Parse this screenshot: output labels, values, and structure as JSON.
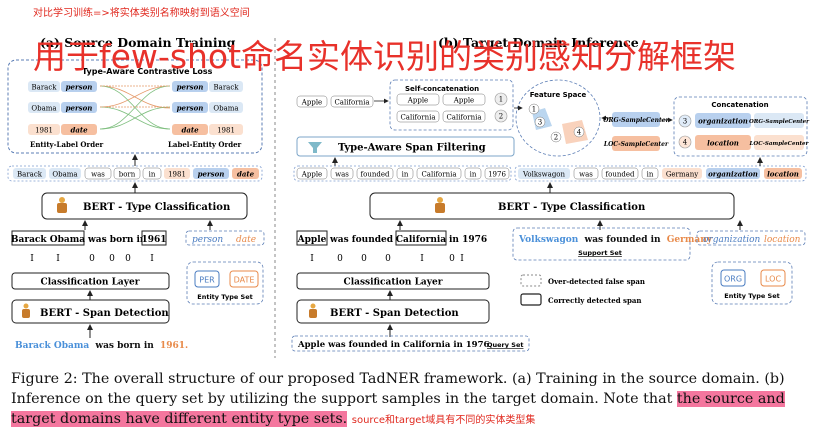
{
  "annotations": {
    "top_note": "对比学习训练=>将实体类别名称映射到语义空间",
    "overlay_title": "用于few-shot命名实体识别的类别感知分解框架",
    "inline_note": "source和target域具有不同的实体类型集"
  },
  "panel_a": {
    "title": "(a) Source Domain Training",
    "contrastive_label": "Type-Aware Contrastive Loss",
    "left_pairs": [
      [
        "Barack",
        "person"
      ],
      [
        "Obama",
        "person"
      ],
      [
        "1981",
        "date"
      ]
    ],
    "right_pairs": [
      [
        "person",
        "Barack"
      ],
      [
        "person",
        "Obama"
      ],
      [
        "date",
        "1981"
      ]
    ],
    "left_order_label": "Entity-Label Order",
    "right_order_label": "Label-Entity Order",
    "token_row": [
      "Barack",
      "Obama",
      "was",
      "born",
      "in",
      "1981",
      "person",
      "date"
    ],
    "bert_type": "BERT - Type Classification",
    "sentence": {
      "entity1": "Barack Obama",
      "mid": "was born in",
      "entity2": "1961"
    },
    "types_inline": [
      "person",
      "date"
    ],
    "binary_labels": [
      "I",
      "I",
      "0",
      "0",
      "0",
      "I"
    ],
    "classification_layer": "Classification Layer",
    "entity_type_boxes": [
      "PER",
      "DATE"
    ],
    "entity_type_set": "Entity Type Set",
    "bert_span": "BERT - Span Detection",
    "input_sentence": {
      "entity": "Barack Obama",
      "mid": "was born in",
      "date": "1961."
    }
  },
  "panel_b": {
    "title": "(b) Target Domain Inference",
    "self_concat_label": "Self-concatenation",
    "apple_row": [
      "Apple",
      "California"
    ],
    "self_concat_rows": [
      [
        "Apple",
        "Apple",
        "1"
      ],
      [
        "California",
        "California",
        "2"
      ]
    ],
    "feature_space": "Feature Space",
    "feature_numbers": [
      "1",
      "2",
      "3",
      "4"
    ],
    "concatenation_label": "Concatenation",
    "sample_centers": [
      "ORG-SampleCenter",
      "LOC-SampleCenter"
    ],
    "concat_rows": [
      [
        "3",
        "organization",
        "ORG-SampleCenter"
      ],
      [
        "4",
        "location",
        "LOC-SampleCenter"
      ]
    ],
    "span_filter": "Type-Aware Span Filtering",
    "query_tokens": [
      "Apple",
      "was",
      "founded",
      "in",
      "California",
      "in",
      "1976"
    ],
    "support_tokens": [
      "Volkswagon",
      "was",
      "founded",
      "in",
      "Germany",
      "organization",
      "location"
    ],
    "bert_type": "BERT - Type Classification",
    "query_sentence": {
      "e1": "Apple",
      "mid": "was founded in",
      "e2": "California",
      "end": "in 1976"
    },
    "support_sentence": {
      "e1": "Volkswagon",
      "mid": "was founded in",
      "e2": "Germany"
    },
    "support_set_label": "Support Set",
    "types_inline": [
      "organization",
      "location"
    ],
    "binary_labels": [
      "I",
      "0",
      "0",
      "0",
      "I",
      "0",
      "I"
    ],
    "classification_layer": "Classification Layer",
    "legend": [
      "Over-detected false span",
      "Correctly detected span"
    ],
    "entity_type_boxes": [
      "ORG",
      "LOC"
    ],
    "entity_type_set": "Entity Type Set",
    "bert_span": "BERT - Span Detection",
    "input_sentence": "Apple was founded in California in 1976",
    "query_set_label": "Query Set"
  },
  "caption": {
    "part1": "Figure 2: The overall structure of our proposed TadNER framework. (a) Training in the source domain. (b) Inference on the query set by utilizing the support samples in the target domain. Note that ",
    "highlight": "the source and target domains have different entity type sets.",
    "part2": " "
  }
}
